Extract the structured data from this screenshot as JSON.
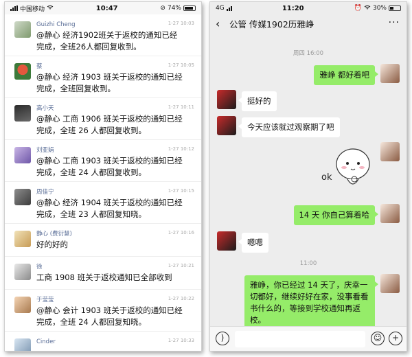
{
  "left": {
    "status": {
      "carrier": "中国移动",
      "time": "10:47",
      "battery": "74%"
    },
    "comments": [
      {
        "name": "Guizhi Cheng",
        "time": "1-27 10:03",
        "text": "@静心 经济1902班关于返校的通知已经完成，全班26人都回复收到。"
      },
      {
        "name": "蔡",
        "time": "1-27 10:05",
        "text": "@静心 经济 1903 班关于返校的通知已经完成，全班回复收到。"
      },
      {
        "name": "高小天",
        "time": "1-27 10:11",
        "text": "@静心 工商 1906 班关于返校的通知已经完成，全班 26 人都回复收到。"
      },
      {
        "name": "刘亚娟",
        "time": "1-27 10:12",
        "text": "@静心 工商 1903 班关于返校的通知已经完成，全班 24 人都回复收到。"
      },
      {
        "name": "周佳宁",
        "time": "1-27 10:15",
        "text": "@静心 经济 1904 班关于返校的通知已经完成，全班 23 人都回复知晓。"
      },
      {
        "name": "静心 (费衍慧)",
        "time": "1-27 10:16",
        "text": "好的好的"
      },
      {
        "name": "徐",
        "time": "1-27 10:21",
        "text": "工商 1908 班关于返校通知已全部收到"
      },
      {
        "name": "于莹莹",
        "time": "1-27 10:22",
        "text": "@静心 会计 1903 班关于返校的通知已经完成，全班 24 人都回复知晓。"
      },
      {
        "name": "Cinder",
        "time": "1-27 10:33",
        "text": ""
      }
    ]
  },
  "right": {
    "status": {
      "network": "4G",
      "time": "11:20",
      "battery": "30%"
    },
    "title": "公管 传媒1902历雅峥",
    "timestamps": [
      "周四 16:00",
      "11:00"
    ],
    "messages": [
      {
        "from": "me",
        "text": "雅峥 都好着吧"
      },
      {
        "from": "them",
        "text": "挺好的"
      },
      {
        "from": "them",
        "text": "今天应该就过观察期了吧"
      },
      {
        "from": "me",
        "sticker": "ok",
        "text": "ok"
      },
      {
        "from": "me",
        "text": "14 天 你自己算着哈"
      },
      {
        "from": "them",
        "text": "嗯嗯"
      },
      {
        "from": "me",
        "text": "雅峥，你已经过 14 天了，庆幸一切都好，继续好好在家，没事看看书什么的，等接到学校通知再返校。"
      }
    ]
  },
  "colors": {
    "me_bubble": "#95ec69",
    "them_bubble": "#ffffff",
    "chat_bg": "#ededed",
    "name_link": "#576b95"
  }
}
